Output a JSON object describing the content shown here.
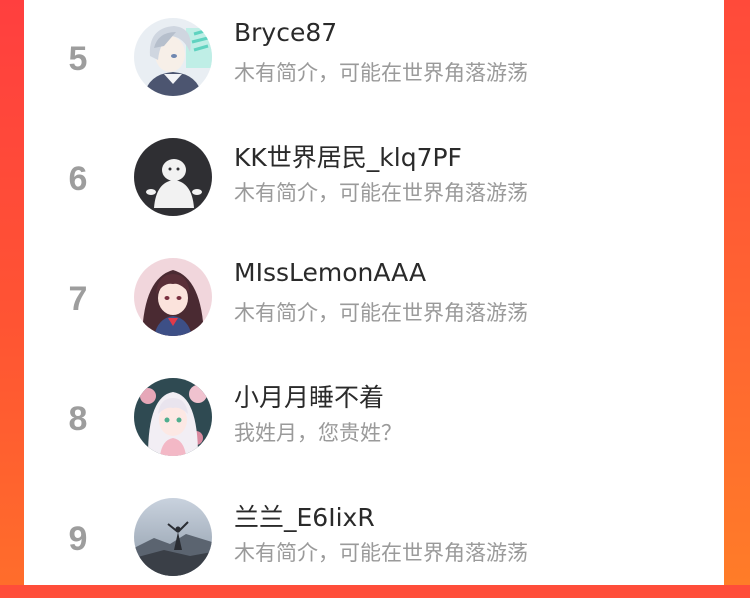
{
  "ranking": [
    {
      "rank": "5",
      "name": "Bryce87",
      "bio": "木有简介，可能在世界角落游荡",
      "avatar_icon": "anime-boy-avatar-icon"
    },
    {
      "rank": "6",
      "name": "KK世界居民_klq7PF",
      "bio": "木有简介，可能在世界角落游荡",
      "avatar_icon": "default-user-avatar-icon"
    },
    {
      "rank": "7",
      "name": "MIssLemonAAA",
      "bio": "木有简介，可能在世界角落游荡",
      "avatar_icon": "anime-girl-avatar-icon"
    },
    {
      "rank": "8",
      "name": "小月月睡不着",
      "bio": "我姓月，您贵姓？",
      "avatar_icon": "anime-girl-flowers-avatar-icon"
    },
    {
      "rank": "9",
      "name": "兰兰_E6IixR",
      "bio": "木有简介，可能在世界角落游荡",
      "avatar_icon": "landscape-avatar-icon"
    }
  ],
  "colors": {
    "background_gradient_top": "#ff4d3a",
    "background_gradient_bottom": "#ff7a2c",
    "card": "#ffffff",
    "rank_text": "#9d9d9d",
    "name_text": "#2a2a2a",
    "bio_text": "#9a9a9a"
  }
}
